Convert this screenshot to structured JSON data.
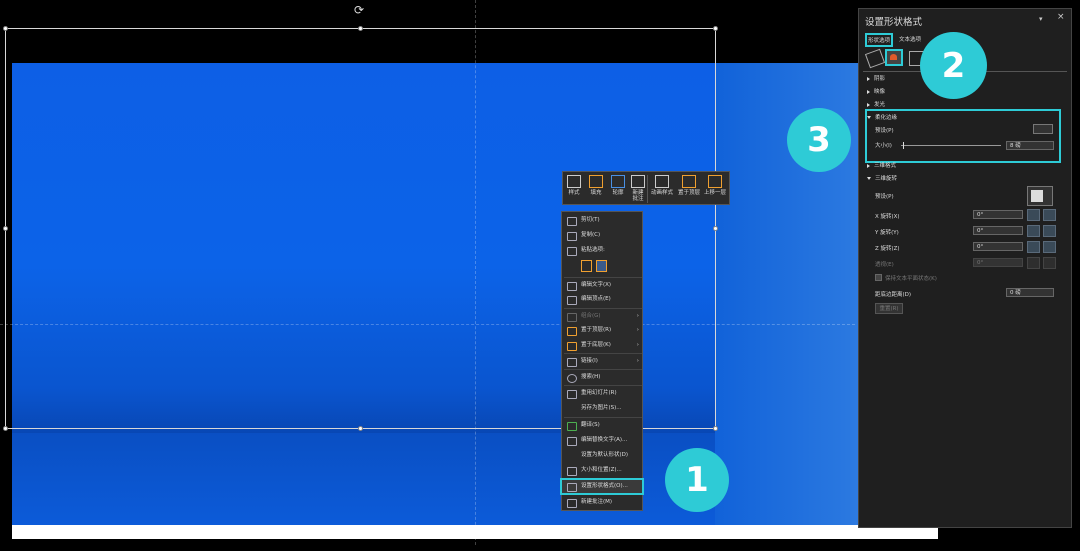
{
  "minitoolbar": {
    "items": [
      {
        "label": "样式",
        "icon": "style-icon"
      },
      {
        "label": "填充",
        "icon": "fill-icon"
      },
      {
        "label": "轮廓",
        "icon": "outline-icon"
      },
      {
        "label": "新建\n批注",
        "icon": "new-comment-icon"
      },
      {
        "label": "动画样式",
        "icon": "animation-style-icon"
      },
      {
        "label": "置于顶层",
        "icon": "bring-to-front-icon"
      },
      {
        "label": "上移一层",
        "icon": "bring-forward-icon"
      }
    ]
  },
  "context_menu": {
    "items": [
      {
        "label": "剪切(T)",
        "icon": "scissors-icon"
      },
      {
        "label": "复制(C)",
        "icon": "copy-icon"
      },
      {
        "label": "粘贴选项:",
        "icon": "paste-icon"
      },
      {
        "label": "编辑文字(X)",
        "icon": "edit-text-icon"
      },
      {
        "label": "编辑顶点(E)",
        "icon": "edit-points-icon"
      },
      {
        "label": "组合(G)",
        "icon": "group-icon"
      },
      {
        "label": "置于顶层(R)",
        "icon": "bring-to-front-icon"
      },
      {
        "label": "置于底层(K)",
        "icon": "send-to-back-icon"
      },
      {
        "label": "链接(I)",
        "icon": "link-icon"
      },
      {
        "label": "搜索(H)",
        "icon": "search-icon"
      },
      {
        "label": "重用幻灯片(R)",
        "icon": "reuse-slides-icon"
      },
      {
        "label": "另存为图片(S)...",
        "icon": ""
      },
      {
        "label": "翻译(S)",
        "icon": "translate-icon"
      },
      {
        "label": "编辑替换文字(A)...",
        "icon": "alt-text-icon"
      },
      {
        "label": "设置为默认形状(D)",
        "icon": ""
      },
      {
        "label": "大小和位置(Z)...",
        "icon": "size-position-icon"
      },
      {
        "label": "设置形状格式(O)...",
        "icon": "format-shape-icon"
      },
      {
        "label": "新建批注(M)",
        "icon": "new-comment-icon"
      }
    ]
  },
  "panel": {
    "title": "设置形状格式",
    "dropdown_glyph": "▾",
    "close_glyph": "×",
    "tabs": [
      "形状选项",
      "文本选项"
    ],
    "sections": {
      "shadow": "阴影",
      "reflection": "映像",
      "glow": "发光",
      "soft_edges": "柔化边缘",
      "preset": "预设(P)",
      "size": "大小(I)",
      "size_value": "8 磅",
      "bevel": "三维格式",
      "rotation": "三维旋转",
      "rotation_preset": "预设(P)",
      "x_rot": "X 旋转(X)",
      "y_rot": "Y 旋转(Y)",
      "z_rot": "Z 旋转(Z)",
      "perspective": "透视(E)",
      "deg": "0°",
      "keep_flat": "保持文本平面状态(K)",
      "distance": "距底边距离(D)",
      "distance_value": "0 磅",
      "reset": "重置(R)"
    }
  },
  "badges": [
    "1",
    "2",
    "3"
  ],
  "colors": {
    "accent": "#2ecbd6",
    "slide_blue": "#0c63e8"
  }
}
